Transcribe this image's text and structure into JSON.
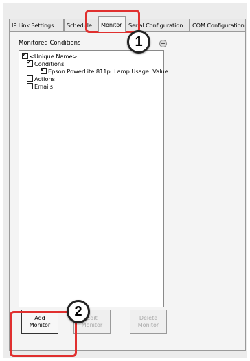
{
  "tabs": [
    {
      "label": "IP Link Settings"
    },
    {
      "label": "Schedule"
    },
    {
      "label": "Monitor"
    },
    {
      "label": "Serial Configuration"
    },
    {
      "label": "COM Configuration"
    }
  ],
  "active_tab": "Monitor",
  "monitored_conditions_label": "Monitored Conditions",
  "tree": {
    "root": {
      "label": "<Unique Name>",
      "checked": true
    },
    "conditions": {
      "label": "Conditions",
      "checked": true
    },
    "condition_item": {
      "label": "Epson PowerLite 811p: Lamp Usage: Value",
      "checked": true
    },
    "actions": {
      "label": "Actions",
      "checked": false
    },
    "emails": {
      "label": "Emails",
      "checked": false
    }
  },
  "buttons": {
    "add_monitor": {
      "line1": "Add",
      "line2": "Monitor",
      "enabled": true
    },
    "edit_monitor": {
      "line1": "Edit",
      "line2": "Monitor",
      "enabled": false
    },
    "delete_monitor": {
      "line1": "Delete",
      "line2": "Monitor",
      "enabled": false
    }
  },
  "callouts": {
    "one": "1",
    "two": "2"
  },
  "colors": {
    "callout": "#e0302f",
    "disabled_text": "#a8a8a8"
  }
}
